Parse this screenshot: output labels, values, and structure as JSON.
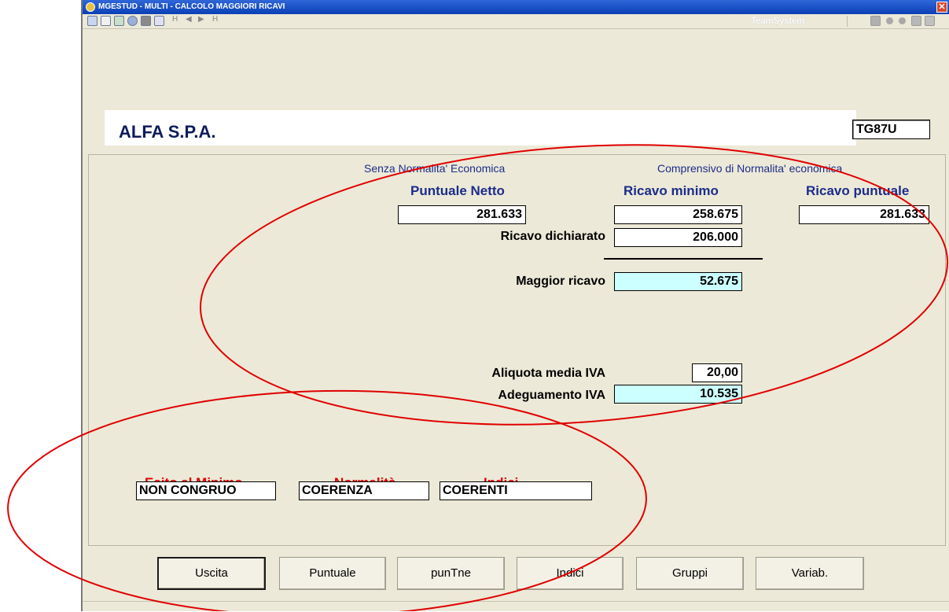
{
  "window": {
    "title": "MGESTUD  - MULTI -  CALCOLO MAGGIORI RICAVI",
    "close_glyph": "✕",
    "brand": "TeamSystem",
    "nav_first": "H",
    "nav_prev": "◀",
    "nav_next": "▶",
    "nav_last": "H"
  },
  "header": {
    "company": "ALFA S.P.A.",
    "code": "TG87U"
  },
  "main": {
    "subhead_left": "Senza Normalita' Economica",
    "subhead_right": "Comprensivo di Normalita' economica",
    "col_puntuale_netto": "Puntuale Netto",
    "col_ricavo_minimo": "Ricavo minimo",
    "col_ricavo_puntuale": "Ricavo puntuale",
    "val_puntuale_netto": "281.633",
    "val_ricavo_minimo": "258.675",
    "val_ricavo_puntuale": "281.633",
    "lbl_ricavo_dichiarato": "Ricavo dichiarato",
    "val_ricavo_dichiarato": "206.000",
    "lbl_maggior_ricavo": "Maggior ricavo",
    "val_maggior_ricavo": "52.675",
    "lbl_aliquota": "Aliquota media IVA",
    "val_aliquota": "20,00",
    "lbl_adeguamento": "Adeguamento IVA",
    "val_adeguamento": "10.535"
  },
  "results": {
    "esito_label": "Esito al Minimo",
    "esito_value": "NON CONGRUO",
    "normalita_label": "Normalità",
    "normalita_value": "COERENZA",
    "indici_label": "Indici",
    "indici_value": "COERENTI"
  },
  "buttons": {
    "uscita": "Uscita",
    "puntuale": "Puntuale",
    "puntne": "punTne",
    "indici": "Indici",
    "gruppi": "Gruppi",
    "variab": "Variab."
  },
  "colors": {
    "titlebar": "#0a3fb5",
    "heading_blue": "#1c2c8a",
    "highlight_cyan": "#ccffff",
    "result_red": "#e00000",
    "annotation_red": "#e00000"
  }
}
